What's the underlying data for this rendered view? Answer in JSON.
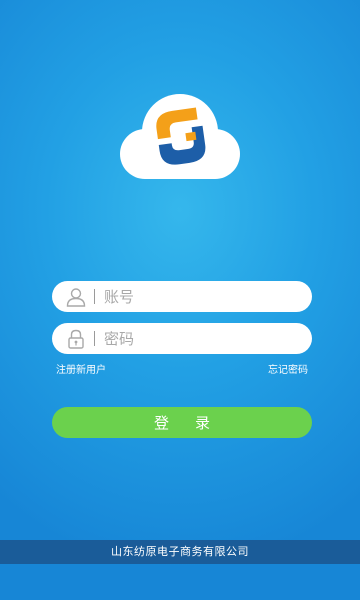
{
  "login_form": {
    "account_placeholder": "账号",
    "password_placeholder": "密码",
    "register_label": "注册新用户",
    "forgot_password_label": "忘记密码",
    "login_label": "登录"
  },
  "footer": {
    "company": "山东纺原电子商务有限公司"
  },
  "icons": {
    "logo": "cloud-logo-icon",
    "account": "user-icon",
    "password": "lock-icon"
  },
  "colors": {
    "background": "#1f9ae2",
    "login_button": "#6bd14d",
    "footer_bar": "#1a5c99",
    "logo_orange": "#f4a019",
    "logo_blue": "#1d5ea8"
  }
}
